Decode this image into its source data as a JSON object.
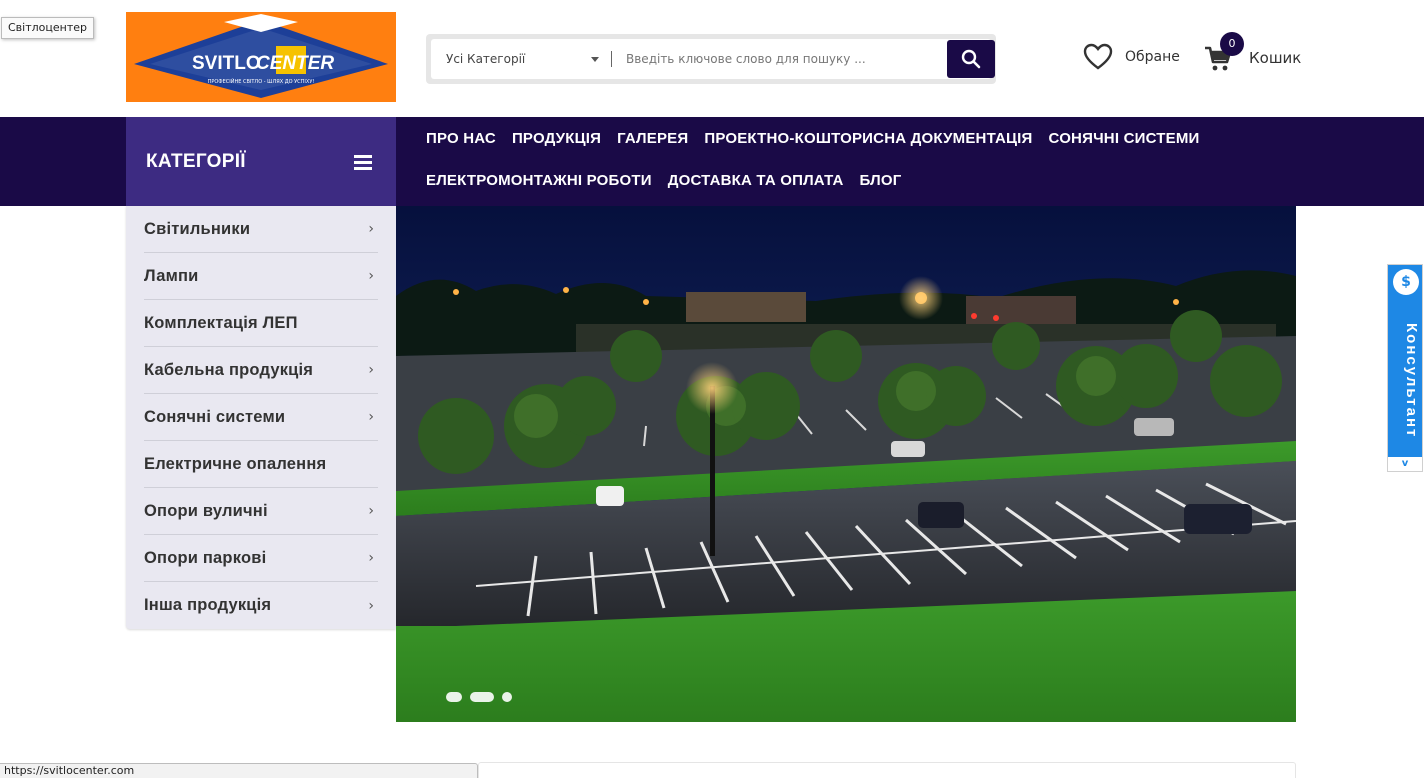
{
  "tooltip": "Світлоцентер",
  "logo": {
    "brand_left": "SVITLO",
    "brand_right": "CENTER",
    "tagline": "ПРОФЕСІЙНЕ СВІТЛО - ШЛЯХ ДО УСПІХУ!",
    "colors": {
      "background": "#ff7f10",
      "diamond": "#1d3f98"
    }
  },
  "search": {
    "category_value": "Усі Категорії",
    "placeholder": "Введіть ключове слово для пошуку ...",
    "button_icon": "search-icon"
  },
  "header": {
    "wishlist_label": "Обране",
    "wishlist_icon": "heart-icon",
    "cart_label": "Кошик",
    "cart_count": "0",
    "cart_icon": "cart-icon"
  },
  "categories": {
    "title": "КАТЕГОРІЇ",
    "items": [
      {
        "label": "Світильники",
        "has_children": true
      },
      {
        "label": "Лампи",
        "has_children": true
      },
      {
        "label": "Комплектація ЛЕП",
        "has_children": false
      },
      {
        "label": "Кабельна продукція",
        "has_children": true
      },
      {
        "label": "Сонячні системи",
        "has_children": true
      },
      {
        "label": "Електричне опалення",
        "has_children": false
      },
      {
        "label": "Опори вуличні",
        "has_children": true
      },
      {
        "label": "Опори паркові",
        "has_children": true
      },
      {
        "label": "Інша продукція",
        "has_children": true
      }
    ]
  },
  "nav": {
    "row1": [
      "ПРО НАС",
      "ПРОДУКЦІЯ",
      "ГАЛЕРЕЯ",
      "ПРОЕКТНО-КОШТОРИСНА ДОКУМЕНТАЦІЯ",
      "СОНЯЧНІ СИСТЕМИ"
    ],
    "row2": [
      "ЕЛЕКТРОМОНТАЖНІ РОБОТИ",
      "ДОСТАВКА ТА ОПЛАТА",
      "БЛОГ"
    ]
  },
  "slider": {
    "slide_count": 3,
    "active_index": 1
  },
  "consultant": {
    "label": "Консультант",
    "icon": "chat-dollar-icon",
    "arrow": "v"
  },
  "status_bar": {
    "url": "https://svitlocenter.com"
  },
  "colors": {
    "nav_bg": "#1a0a47",
    "category_header": "#3d2b82",
    "sidebar_bg": "#e9e8f1",
    "consult_bg": "#1e88e5"
  }
}
